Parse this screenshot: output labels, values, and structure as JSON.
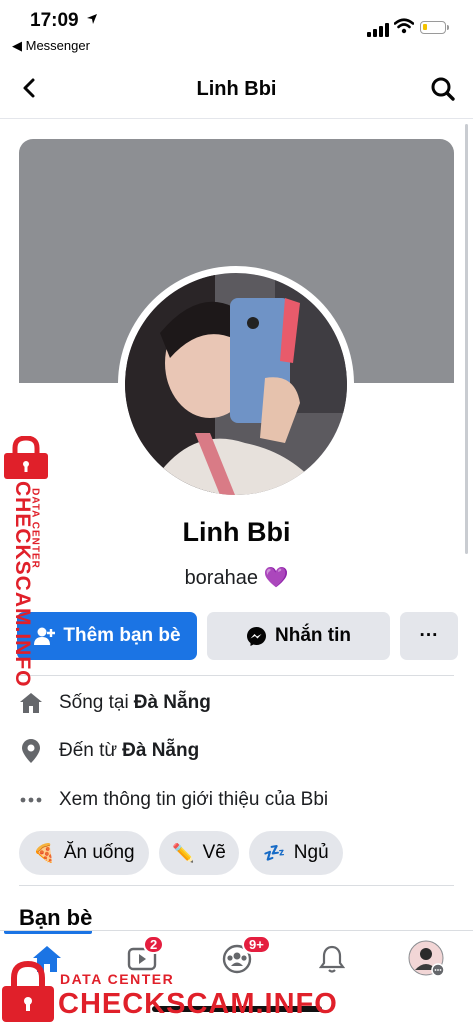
{
  "status_bar": {
    "time": "17:09",
    "back_app": "◀ Messenger"
  },
  "header": {
    "title": "Linh Bbi"
  },
  "profile": {
    "name": "Linh Bbi",
    "bio": "borahae 💜"
  },
  "actions": {
    "add_friend": "Thêm bạn bè",
    "message": "Nhắn tin",
    "more": "···"
  },
  "details": {
    "lives_prefix": "Sống tại",
    "lives_place": "Đà Nẵng",
    "from_prefix": "Đến từ",
    "from_place": "Đà Nẵng",
    "see_info": "Xem thông tin giới thiệu của Bbi"
  },
  "hobbies": [
    {
      "emoji": "🍕",
      "label": "Ăn uống"
    },
    {
      "emoji": "✏️",
      "label": "Vẽ"
    },
    {
      "emoji": "💤",
      "label": "Ngủ"
    }
  ],
  "sections": {
    "friends": "Bạn bè"
  },
  "tabbar": {
    "video_badge": "2",
    "groups_badge": "9+"
  },
  "watermark": {
    "data_center": "DATA CENTER",
    "site": "CHECKSCAM.INFO"
  },
  "colors": {
    "accent": "#1b74e4",
    "badge": "#e41e3f",
    "watermark": "#e0202a",
    "cover": "#8d8f93"
  }
}
